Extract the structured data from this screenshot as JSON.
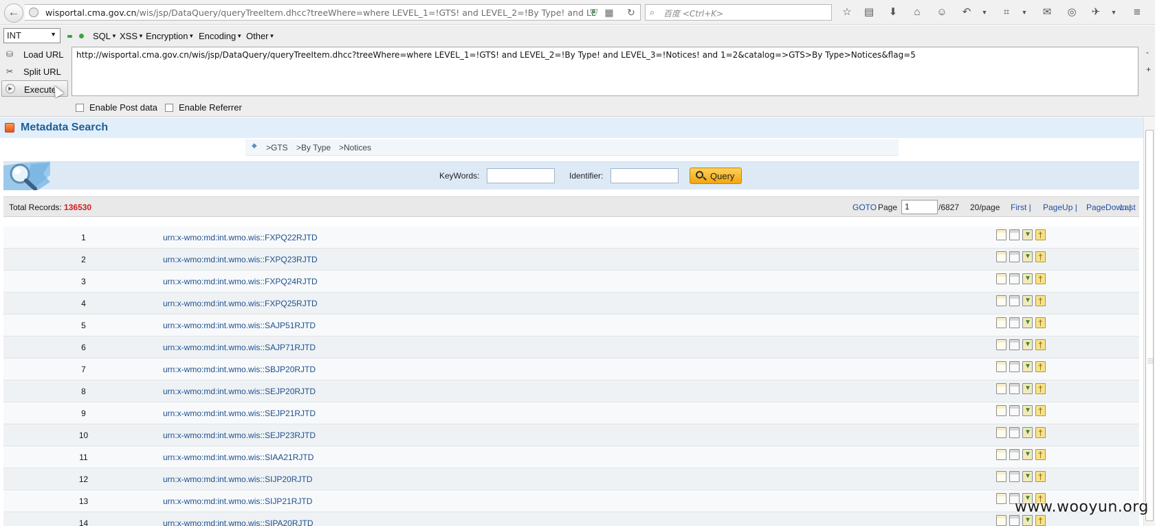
{
  "browser": {
    "url_host": "wisportal.cma.gov.cn",
    "url_path": "/wis/jsp/DataQuery/queryTreeItem.dhcc?treeWhere=where LEVEL_1=!GTS! and LEVEL_2=!By Type! and LEVEL_3",
    "search_placeholder": "百度 <Ctrl+K>",
    "back_icon": "arrow-left-icon"
  },
  "hackbar": {
    "select_value": "INT",
    "menus": [
      "SQL",
      "XSS",
      "Encryption",
      "Encoding",
      "Other"
    ],
    "load_url_label": "Load URL",
    "split_url_label": "Split URL",
    "execute_label": "Execute",
    "url_value": "http://wisportal.cma.gov.cn/wis/jsp/DataQuery/queryTreeItem.dhcc?treeWhere=where LEVEL_1=!GTS! and LEVEL_2=!By Type! and LEVEL_3=!Notices! and 1=2&catalog=>GTS>By Type>Notices&flag=5",
    "side_minus": "-",
    "side_plus": "+",
    "enable_post_label": "Enable Post data",
    "enable_referrer_label": "Enable Referrer"
  },
  "page": {
    "title": "Metadata Search",
    "breadcrumb": [
      ">GTS",
      ">By Type",
      ">Notices"
    ],
    "search": {
      "keywords_label": "KeyWords:",
      "identifier_label": "Identifier:",
      "query_label": "Query"
    },
    "records": {
      "total_label": "Total Records:",
      "total_value": "136530",
      "goto_label": "GOTO",
      "page_label": "Page",
      "page_value": "1",
      "page_total": "/6827",
      "per_page": "20/page",
      "first": "First",
      "page_up": "PageUp",
      "page_down": "PageDown",
      "last": "Last"
    },
    "rows": [
      {
        "num": "1",
        "id": "urn:x-wmo:md:int.wmo.wis::FXPQ22RJTD"
      },
      {
        "num": "2",
        "id": "urn:x-wmo:md:int.wmo.wis::FXPQ23RJTD"
      },
      {
        "num": "3",
        "id": "urn:x-wmo:md:int.wmo.wis::FXPQ24RJTD"
      },
      {
        "num": "4",
        "id": "urn:x-wmo:md:int.wmo.wis::FXPQ25RJTD"
      },
      {
        "num": "5",
        "id": "urn:x-wmo:md:int.wmo.wis::SAJP51RJTD"
      },
      {
        "num": "6",
        "id": "urn:x-wmo:md:int.wmo.wis::SAJP71RJTD"
      },
      {
        "num": "7",
        "id": "urn:x-wmo:md:int.wmo.wis::SBJP20RJTD"
      },
      {
        "num": "8",
        "id": "urn:x-wmo:md:int.wmo.wis::SEJP20RJTD"
      },
      {
        "num": "9",
        "id": "urn:x-wmo:md:int.wmo.wis::SEJP21RJTD"
      },
      {
        "num": "10",
        "id": "urn:x-wmo:md:int.wmo.wis::SEJP23RJTD"
      },
      {
        "num": "11",
        "id": "urn:x-wmo:md:int.wmo.wis::SIAA21RJTD"
      },
      {
        "num": "12",
        "id": "urn:x-wmo:md:int.wmo.wis::SIJP20RJTD"
      },
      {
        "num": "13",
        "id": "urn:x-wmo:md:int.wmo.wis::SIJP21RJTD"
      },
      {
        "num": "14",
        "id": "urn:x-wmo:md:int.wmo.wis::SIPA20RJTD"
      }
    ]
  },
  "watermark": "www.wooyun.org",
  "colors": {
    "title_blue": "#1f5e98",
    "total_red": "#d21b1b",
    "link_blue": "#1f4f8d",
    "query_orange": "#f2a50f"
  }
}
